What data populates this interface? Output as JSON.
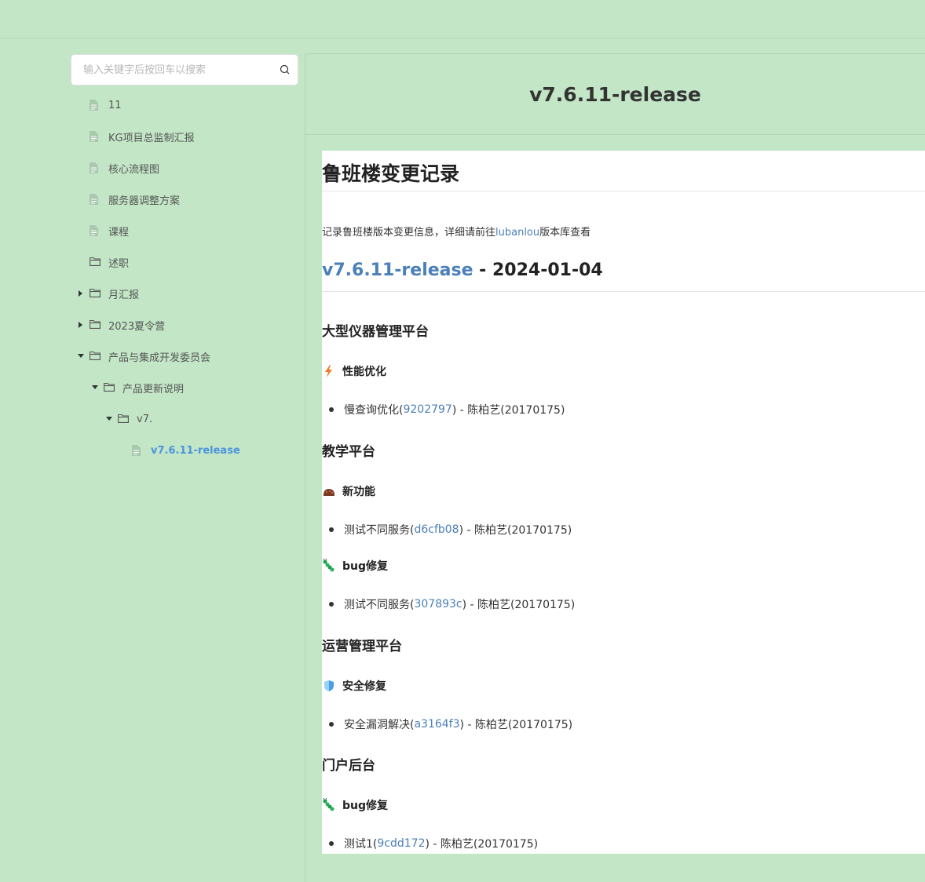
{
  "search": {
    "placeholder": "输入关键字后按回车以搜索"
  },
  "sidebar": {
    "items": [
      {
        "label": "11"
      },
      {
        "label": "KG项目总监制汇报"
      },
      {
        "label": "核心流程图"
      },
      {
        "label": "服务器调整方案"
      },
      {
        "label": "课程"
      },
      {
        "label": "述职"
      },
      {
        "label": "月汇报"
      },
      {
        "label": "2023夏令营"
      },
      {
        "label": "产品与集成开发委员会"
      },
      {
        "label": "产品更新说明"
      },
      {
        "label": "v7."
      },
      {
        "label": "v7.6.11-release"
      }
    ]
  },
  "main": {
    "title": "v7.6.11-release"
  },
  "doc": {
    "h1": "鲁班楼变更记录",
    "intro_before": "记录鲁班楼版本变更信息，详细请前往",
    "intro_link": "lubanlou",
    "intro_after": "版本库查看",
    "version_link": "v7.6.11-release",
    "version_date": " - 2024-01-04",
    "sections": [
      {
        "title": "大型仪器管理平台",
        "groups": [
          {
            "icon": "lightning-icon",
            "title": "性能优化",
            "items": [
              {
                "text": "慢查询优化(",
                "hash": "9202797",
                "after": ") - 陈柏艺(20170175)"
              }
            ]
          }
        ]
      },
      {
        "title": "教学平台",
        "groups": [
          {
            "icon": "sparkle-icon",
            "title": "新功能",
            "items": [
              {
                "text": "测试不同服务(",
                "hash": "d6cfb08",
                "after": ") - 陈柏艺(20170175)"
              }
            ]
          },
          {
            "icon": "bug-icon",
            "title": "bug修复",
            "items": [
              {
                "text": "测试不同服务(",
                "hash": "307893c",
                "after": ") - 陈柏艺(20170175)"
              }
            ]
          }
        ]
      },
      {
        "title": "运营管理平台",
        "groups": [
          {
            "icon": "shield-icon",
            "title": "安全修复",
            "items": [
              {
                "text": "安全漏洞解决(",
                "hash": "a3164f3",
                "after": ") - 陈柏艺(20170175)"
              }
            ]
          }
        ]
      },
      {
        "title": "门户后台",
        "groups": [
          {
            "icon": "bug-icon",
            "title": "bug修复",
            "items": [
              {
                "text": "测试1(",
                "hash": "9cdd172",
                "after": ") - 陈柏艺(20170175)"
              }
            ]
          }
        ]
      }
    ]
  },
  "colors": {
    "background": "#c2e6c6",
    "link": "#4b7fb8",
    "active": "#4b93de"
  }
}
